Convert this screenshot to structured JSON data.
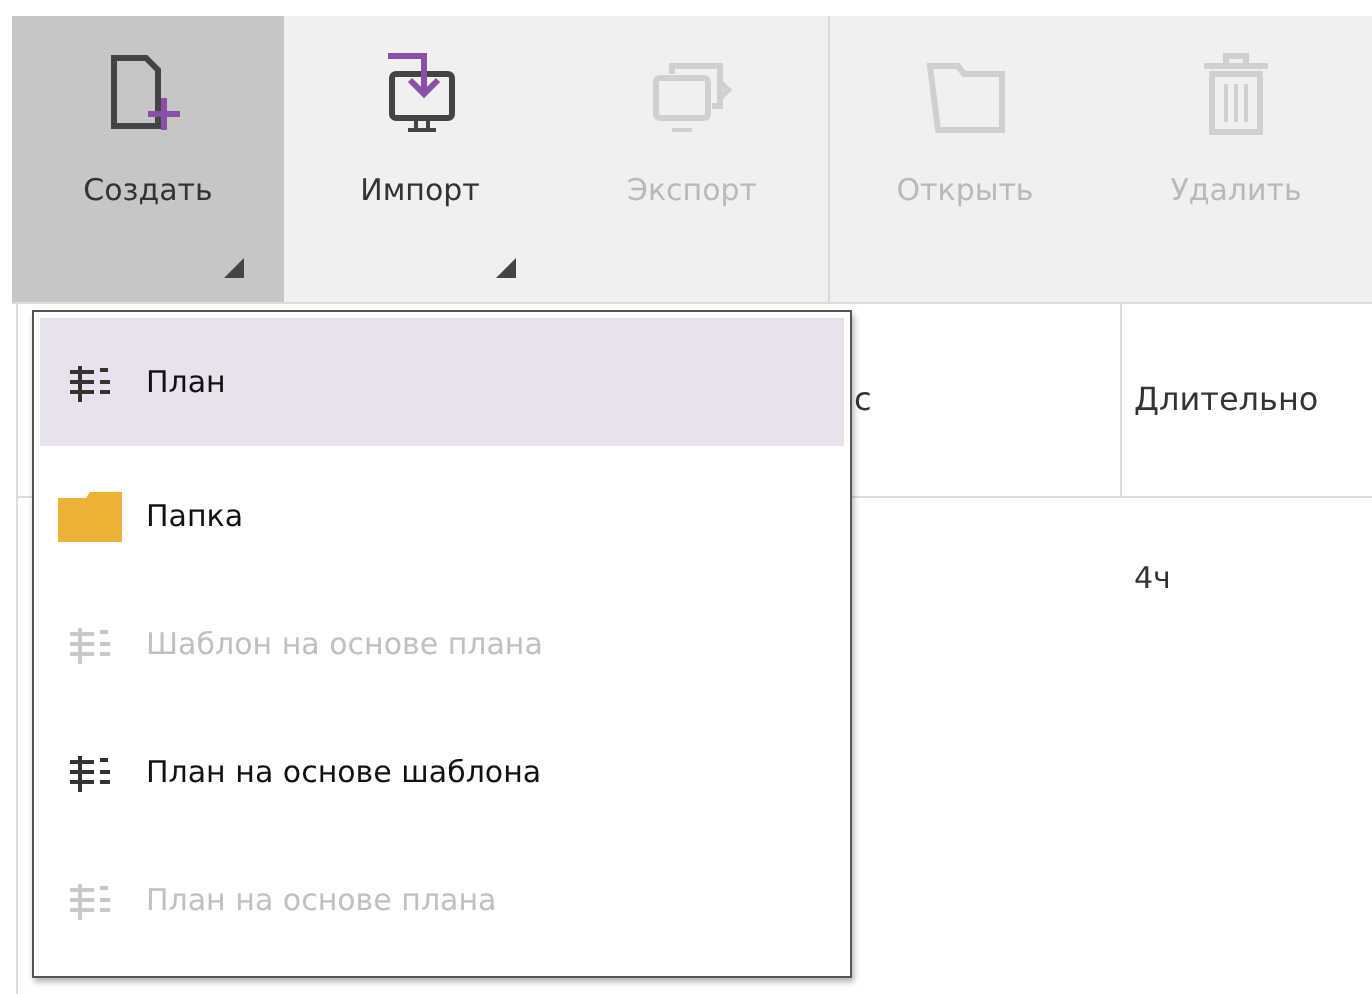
{
  "toolbar": [
    {
      "label": "Создать",
      "kind": "new-file",
      "disabled": false,
      "pressed": true,
      "dropdown": true
    },
    {
      "label": "Импорт",
      "kind": "import",
      "disabled": false,
      "pressed": false,
      "dropdown": true
    },
    {
      "label": "Экспорт",
      "kind": "export",
      "disabled": true,
      "pressed": false,
      "dropdown": false
    },
    {
      "label": "Открыть",
      "kind": "folder",
      "disabled": true,
      "pressed": false,
      "dropdown": false
    },
    {
      "label": "Удалить",
      "kind": "trash",
      "disabled": true,
      "pressed": false,
      "dropdown": false
    }
  ],
  "table": {
    "columns": [
      "с",
      "Длительно"
    ],
    "rows": [
      [
        "",
        "4ч"
      ]
    ]
  },
  "menu": {
    "items": [
      {
        "label": "План",
        "kind": "plan",
        "disabled": false,
        "selected": true
      },
      {
        "label": "Папка",
        "kind": "folder",
        "disabled": false,
        "selected": false
      },
      {
        "label": "Шаблон на основе плана",
        "kind": "plan",
        "disabled": true,
        "selected": false
      },
      {
        "label": "План на основе шаблона",
        "kind": "plan",
        "disabled": false,
        "selected": false
      },
      {
        "label": "План на основе плана",
        "kind": "plan",
        "disabled": true,
        "selected": false
      }
    ]
  }
}
